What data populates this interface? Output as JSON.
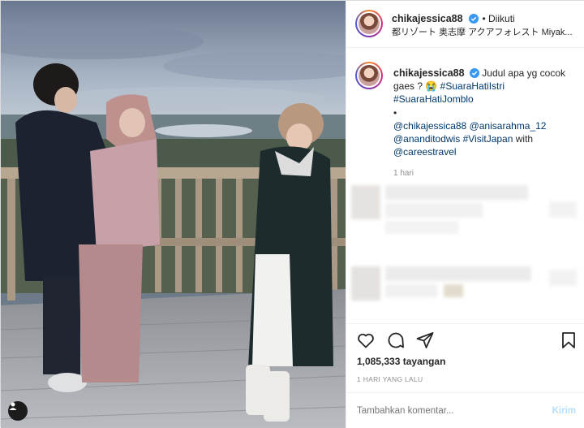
{
  "post": {
    "username": "chikajessica88",
    "follow_state": "• Diikuti",
    "location": "都リゾート 奥志摩 アクアフォレスト   Miyak...",
    "caption": {
      "title_text": "Judul apa yg cocok gaes ? ",
      "emoji": "😭",
      "hashtag1": "#SuaraHatiIstri",
      "hashtag2": "#SuaraHatiJomblo",
      "bullet": "•",
      "mention1": "@chikajessica88",
      "mention2": "@anisarahma_12",
      "mention3": "@ananditodwis",
      "hashtag3": "#VisitJapan",
      "with_text": "with",
      "mention4": "@careestravel"
    },
    "caption_time": "1 hari",
    "views": "1,085,333 tayangan",
    "posted_ago": "1 HARI YANG LALU",
    "comment_placeholder": "Tambahkan komentar...",
    "post_label": "Kirim"
  },
  "icons": {
    "verified": "verified-badge-icon",
    "like": "heart-icon",
    "comment": "comment-bubble-icon",
    "share": "paper-plane-icon",
    "save": "bookmark-icon",
    "user_tag": "user-tag-icon"
  },
  "colors": {
    "verified": "#3897f0",
    "link": "#00376b",
    "muted": "#8e8e8e",
    "post_disabled": "#b2dffc"
  }
}
